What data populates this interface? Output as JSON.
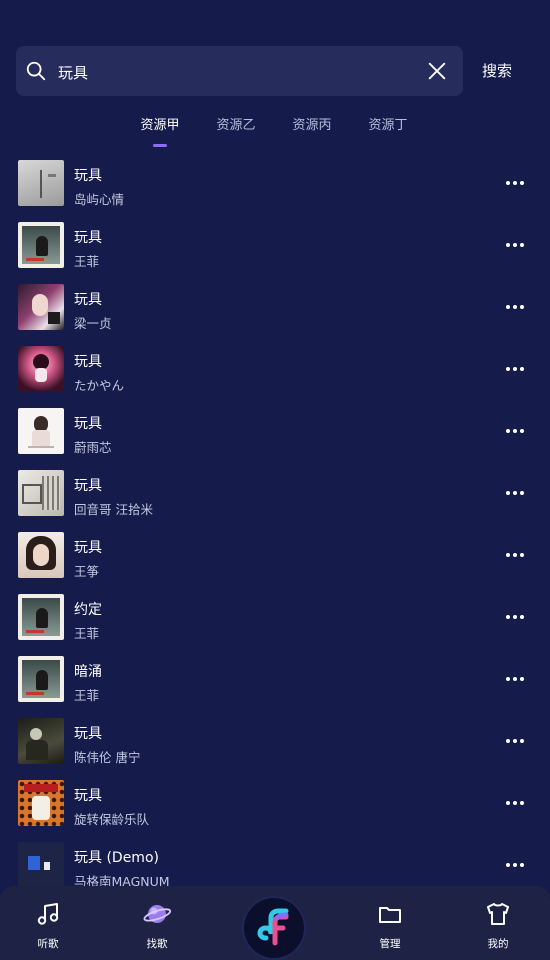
{
  "search": {
    "query": "玩具",
    "button_label": "搜索"
  },
  "tabs": [
    {
      "label": "资源甲",
      "active": true
    },
    {
      "label": "资源乙",
      "active": false
    },
    {
      "label": "资源丙",
      "active": false
    },
    {
      "label": "资源丁",
      "active": false
    }
  ],
  "results": [
    {
      "title": "玩具",
      "artist": "岛屿心情"
    },
    {
      "title": "玩具",
      "artist": "王菲"
    },
    {
      "title": "玩具",
      "artist": "梁一贞"
    },
    {
      "title": "玩具",
      "artist": "たかやん"
    },
    {
      "title": "玩具",
      "artist": "蔚雨芯"
    },
    {
      "title": "玩具",
      "artist": "回音哥  汪拾米"
    },
    {
      "title": "玩具",
      "artist": "王筝"
    },
    {
      "title": "约定",
      "artist": "王菲"
    },
    {
      "title": "暗涌",
      "artist": "王菲"
    },
    {
      "title": "玩具",
      "artist": "陈伟伦  唐宁"
    },
    {
      "title": "玩具",
      "artist": "旋转保龄乐队"
    },
    {
      "title": "玩具 (Demo)",
      "artist": "马格南MAGNUM"
    }
  ],
  "bottom_nav": [
    {
      "label": "听歌",
      "icon": "music-note-icon"
    },
    {
      "label": "找歌",
      "icon": "planet-icon"
    },
    {
      "label": "",
      "icon": "app-logo-icon"
    },
    {
      "label": "管理",
      "icon": "folder-icon"
    },
    {
      "label": "我的",
      "icon": "tshirt-icon"
    }
  ],
  "colors": {
    "background": "#151b4b",
    "search_box": "#262d5c",
    "accent": "#8a6cf5",
    "nav_bar": "#1e2345",
    "secondary_text": "#c4c8e0"
  }
}
